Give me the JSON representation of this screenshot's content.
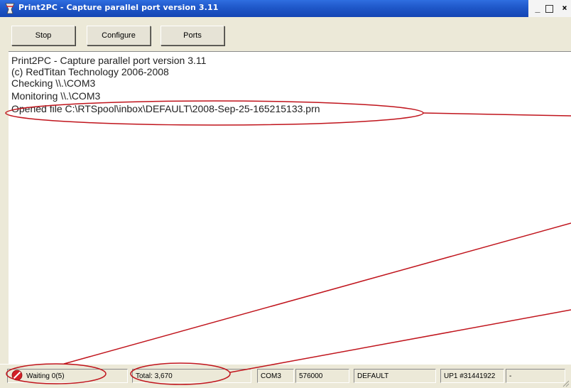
{
  "window": {
    "title": "Print2PC - Capture parallel port version 3.11",
    "controls": {
      "minimize": "_",
      "maximize": "",
      "close": "×"
    }
  },
  "toolbar": {
    "stop_label": "Stop",
    "configure_label": "Configure",
    "ports_label": "Ports"
  },
  "log": {
    "lines": [
      "Print2PC - Capture parallel port version 3.11",
      "(c) RedTitan Technology 2006-2008",
      "Checking \\\\.\\COM3",
      "Monitoring \\\\.\\COM3",
      "Opened file C:\\RTSpool\\inbox\\DEFAULT\\2008-Sep-25-165215133.prn"
    ]
  },
  "status": {
    "waiting": "Waiting 0(5)",
    "total": "Total: 3,670",
    "port": "COM3",
    "baud": "576000",
    "profile": "DEFAULT",
    "up": "UP1 #31441922",
    "last": "-"
  },
  "icons": {
    "app": "printer-arrow-icon",
    "status": "stop-icon"
  },
  "colors": {
    "titlebar": "#1f57c8",
    "annotation": "#c0141c",
    "stop_icon": "#d32027"
  }
}
